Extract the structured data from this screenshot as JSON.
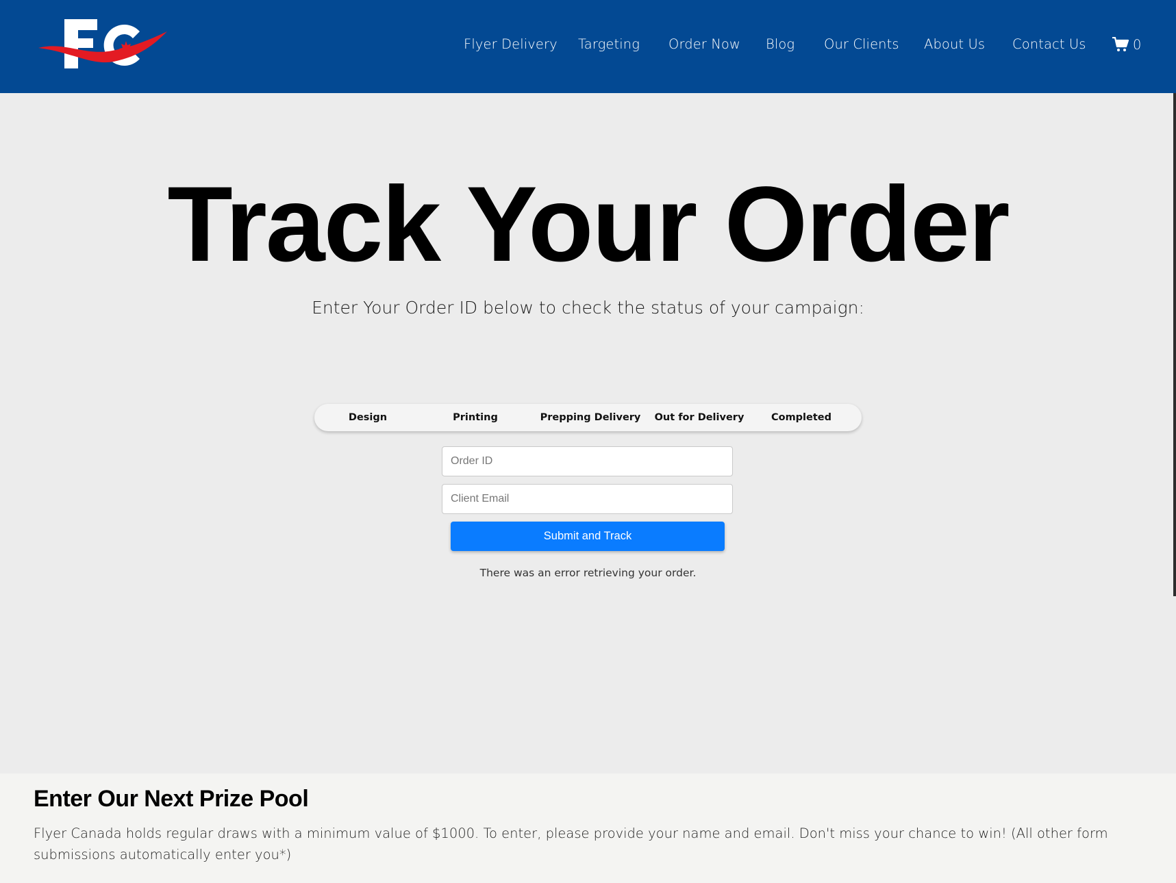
{
  "header": {
    "logo_text": "FC",
    "nav": [
      {
        "label": "Flyer Delivery"
      },
      {
        "label": "Targeting"
      },
      {
        "label": "Order Now"
      },
      {
        "label": "Blog"
      },
      {
        "label": "Our Clients"
      },
      {
        "label": "About Us"
      },
      {
        "label": "Contact Us"
      }
    ],
    "cart_count": "0"
  },
  "hero": {
    "title": "Track Your Order",
    "subtitle": "Enter Your Order ID below to check the status of your campaign:"
  },
  "progress_steps": [
    {
      "label": "Design"
    },
    {
      "label": "Printing"
    },
    {
      "label": "Prepping Delivery"
    },
    {
      "label": "Out for Delivery"
    },
    {
      "label": "Completed"
    }
  ],
  "form": {
    "order_id_placeholder": "Order ID",
    "order_id_value": "",
    "email_placeholder": "Client Email",
    "email_value": "",
    "submit_label": "Submit and Track",
    "error_message": "There was an error retrieving your order."
  },
  "prize": {
    "heading": "Enter Our Next Prize Pool",
    "body": "Flyer Canada holds regular draws with a minimum value of $1000. To enter, please provide your name and email. Don't miss your chance to win! (All other form submissions automatically enter you*)"
  },
  "colors": {
    "header_bg": "#034993",
    "brand_red": "#e31b23",
    "button_blue": "#0a7cff",
    "page_bg": "#ececec"
  },
  "icons": {
    "cart": "shopping-cart-icon",
    "logo_leaf": "maple-leaf-icon"
  }
}
